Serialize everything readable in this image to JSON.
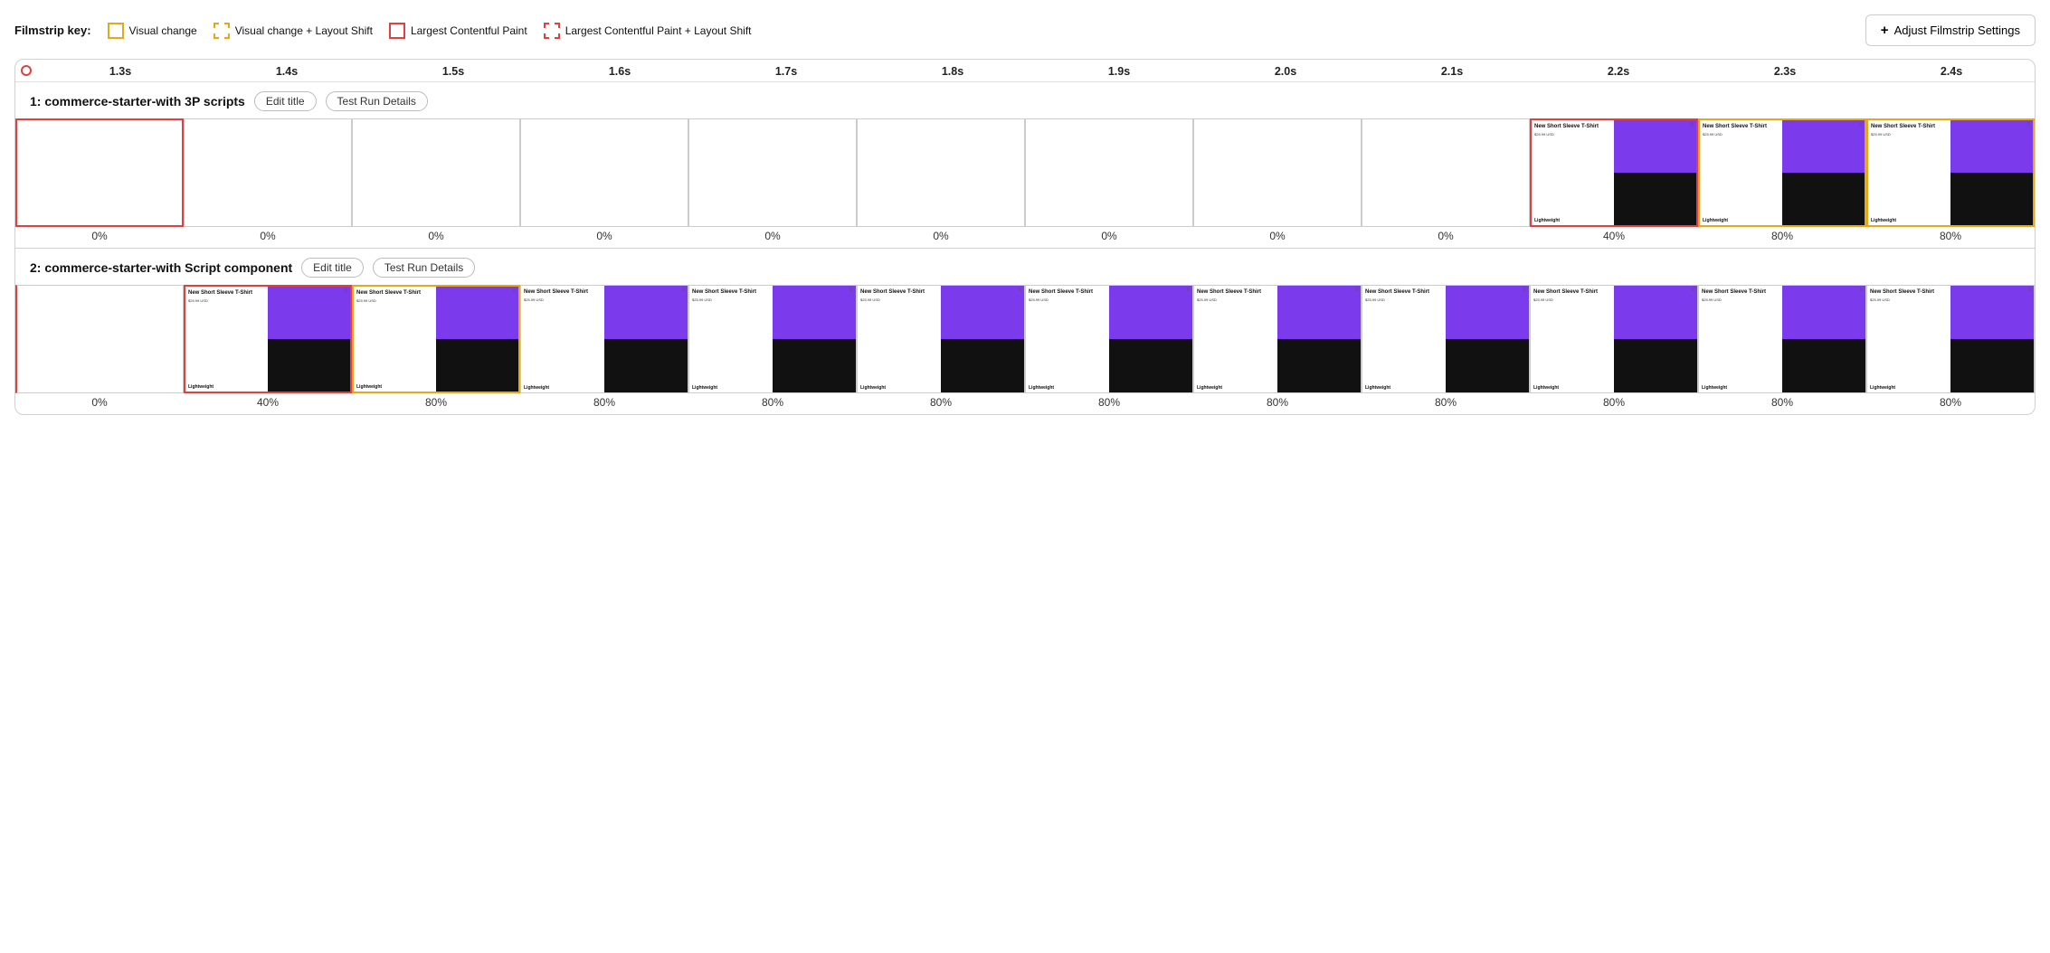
{
  "filmstripKey": {
    "label": "Filmstrip key:",
    "items": [
      {
        "id": "visual-change",
        "label": "Visual change",
        "borderStyle": "solid",
        "borderColor": "#e6a817"
      },
      {
        "id": "visual-change-layout-shift",
        "label": "Visual change + Layout Shift",
        "borderStyle": "dashed",
        "borderColor": "#e6a817"
      },
      {
        "id": "lcp",
        "label": "Largest Contentful Paint",
        "borderStyle": "solid",
        "borderColor": "#e53e3e"
      },
      {
        "id": "lcp-layout-shift",
        "label": "Largest Contentful Paint + Layout Shift",
        "borderStyle": "dashed",
        "borderColor": "#e53e3e"
      }
    ]
  },
  "adjustBtn": {
    "label": "Adjust Filmstrip Settings",
    "icon": "+"
  },
  "timeline": {
    "ticks": [
      "1.3s",
      "1.4s",
      "1.5s",
      "1.6s",
      "1.7s",
      "1.8s",
      "1.9s",
      "2.0s",
      "2.1s",
      "2.2s",
      "2.3s",
      "2.4s"
    ]
  },
  "sections": [
    {
      "id": "section-1",
      "title": "1: commerce-starter-with 3P scripts",
      "editLabel": "Edit title",
      "detailsLabel": "Test Run Details",
      "frames": [
        {
          "blank": true,
          "borderClass": "border-red first-col",
          "percent": "0%"
        },
        {
          "blank": true,
          "borderClass": "",
          "percent": "0%"
        },
        {
          "blank": true,
          "borderClass": "",
          "percent": "0%"
        },
        {
          "blank": true,
          "borderClass": "",
          "percent": "0%"
        },
        {
          "blank": true,
          "borderClass": "",
          "percent": "0%"
        },
        {
          "blank": true,
          "borderClass": "",
          "percent": "0%"
        },
        {
          "blank": true,
          "borderClass": "",
          "percent": "0%"
        },
        {
          "blank": true,
          "borderClass": "",
          "percent": "0%"
        },
        {
          "blank": true,
          "borderClass": "",
          "percent": "0%"
        },
        {
          "blank": false,
          "borderClass": "border-red",
          "percent": "40%"
        },
        {
          "blank": false,
          "borderClass": "border-yellow",
          "percent": "80%"
        },
        {
          "blank": false,
          "borderClass": "border-yellow",
          "percent": "80%"
        }
      ]
    },
    {
      "id": "section-2",
      "title": "2: commerce-starter-with Script component",
      "editLabel": "Edit title",
      "detailsLabel": "Test Run Details",
      "frames": [
        {
          "blank": true,
          "borderClass": "first-col",
          "percent": "0%"
        },
        {
          "blank": false,
          "borderClass": "border-red",
          "percent": "40%"
        },
        {
          "blank": false,
          "borderClass": "border-yellow",
          "percent": "80%"
        },
        {
          "blank": false,
          "borderClass": "",
          "percent": "80%"
        },
        {
          "blank": false,
          "borderClass": "",
          "percent": "80%"
        },
        {
          "blank": false,
          "borderClass": "",
          "percent": "80%"
        },
        {
          "blank": false,
          "borderClass": "",
          "percent": "80%"
        },
        {
          "blank": false,
          "borderClass": "",
          "percent": "80%"
        },
        {
          "blank": false,
          "borderClass": "",
          "percent": "80%"
        },
        {
          "blank": false,
          "borderClass": "",
          "percent": "80%"
        },
        {
          "blank": false,
          "borderClass": "",
          "percent": "80%"
        },
        {
          "blank": false,
          "borderClass": "",
          "percent": "80%"
        }
      ]
    }
  ],
  "productCard": {
    "title": "New Short Sleeve T-Shirt",
    "price": "$25.99 USD",
    "footer": "Lightweight"
  }
}
